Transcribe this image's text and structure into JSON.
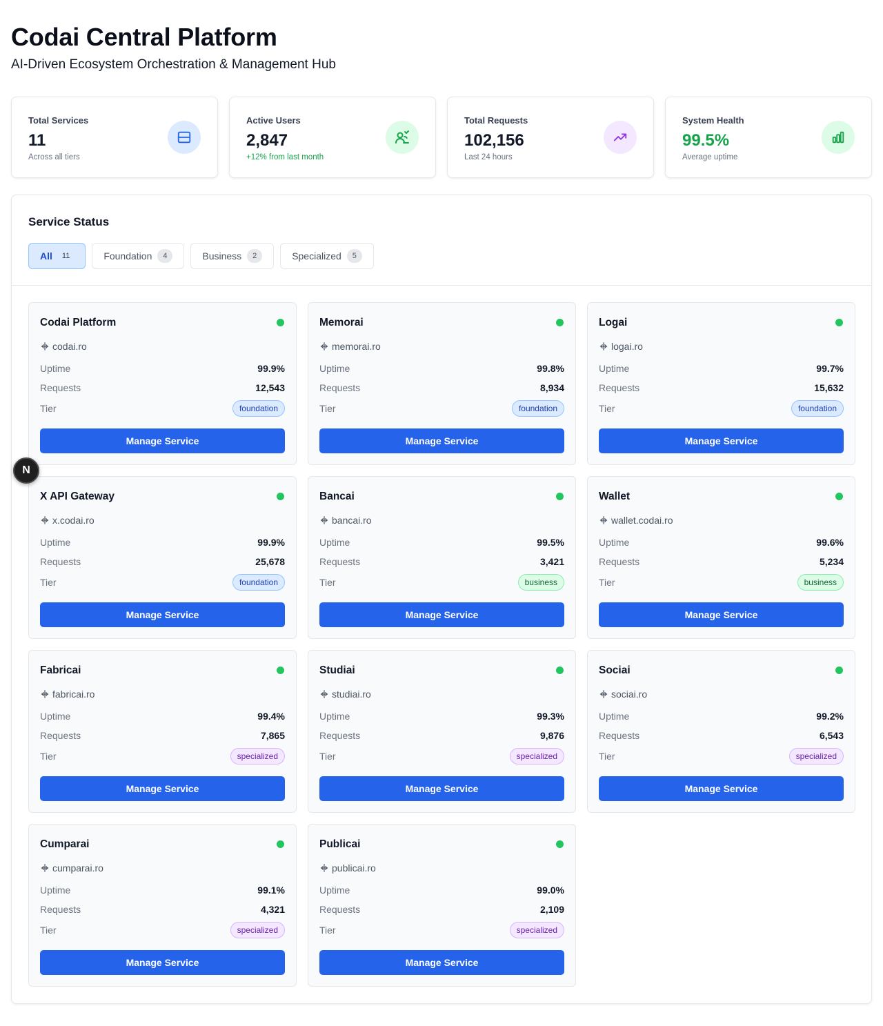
{
  "header": {
    "title": "Codai Central Platform",
    "subtitle": "AI-Driven Ecosystem Orchestration & Management Hub"
  },
  "stats": [
    {
      "label": "Total Services",
      "value": "11",
      "sub": "Across all tiers",
      "icon": "server-icon",
      "accent": "#2563eb"
    },
    {
      "label": "Active Users",
      "value": "2,847",
      "sub": "+12% from last month",
      "icon": "users-icon",
      "accent": "#16a34a"
    },
    {
      "label": "Total Requests",
      "value": "102,156",
      "sub": "Last 24 hours",
      "icon": "trending-up-icon",
      "accent": "#9333ea"
    },
    {
      "label": "System Health",
      "value": "99.5%",
      "sub": "Average uptime",
      "icon": "bar-chart-icon",
      "accent": "#16a34a"
    }
  ],
  "panel": {
    "title": "Service Status",
    "filters": [
      {
        "label": "All",
        "count": "11",
        "active": true
      },
      {
        "label": "Foundation",
        "count": "4",
        "active": false
      },
      {
        "label": "Business",
        "count": "2",
        "active": false
      },
      {
        "label": "Specialized",
        "count": "5",
        "active": false
      }
    ]
  },
  "labels": {
    "uptime": "Uptime",
    "requests": "Requests",
    "tier": "Tier",
    "manage": "Manage Service"
  },
  "services": [
    {
      "name": "Codai Platform",
      "domain": "codai.ro",
      "uptime": "99.9%",
      "requests": "12,543",
      "tier": "foundation"
    },
    {
      "name": "Memorai",
      "domain": "memorai.ro",
      "uptime": "99.8%",
      "requests": "8,934",
      "tier": "foundation"
    },
    {
      "name": "Logai",
      "domain": "logai.ro",
      "uptime": "99.7%",
      "requests": "15,632",
      "tier": "foundation"
    },
    {
      "name": "X API Gateway",
      "domain": "x.codai.ro",
      "uptime": "99.9%",
      "requests": "25,678",
      "tier": "foundation"
    },
    {
      "name": "Bancai",
      "domain": "bancai.ro",
      "uptime": "99.5%",
      "requests": "3,421",
      "tier": "business"
    },
    {
      "name": "Wallet",
      "domain": "wallet.codai.ro",
      "uptime": "99.6%",
      "requests": "5,234",
      "tier": "business"
    },
    {
      "name": "Fabricai",
      "domain": "fabricai.ro",
      "uptime": "99.4%",
      "requests": "7,865",
      "tier": "specialized"
    },
    {
      "name": "Studiai",
      "domain": "studiai.ro",
      "uptime": "99.3%",
      "requests": "9,876",
      "tier": "specialized"
    },
    {
      "name": "Sociai",
      "domain": "sociai.ro",
      "uptime": "99.2%",
      "requests": "6,543",
      "tier": "specialized"
    },
    {
      "name": "Cumparai",
      "domain": "cumparai.ro",
      "uptime": "99.1%",
      "requests": "4,321",
      "tier": "specialized"
    },
    {
      "name": "Publicai",
      "domain": "publicai.ro",
      "uptime": "99.0%",
      "requests": "2,109",
      "tier": "specialized"
    }
  ],
  "dev_badge": {
    "letter": "N"
  }
}
